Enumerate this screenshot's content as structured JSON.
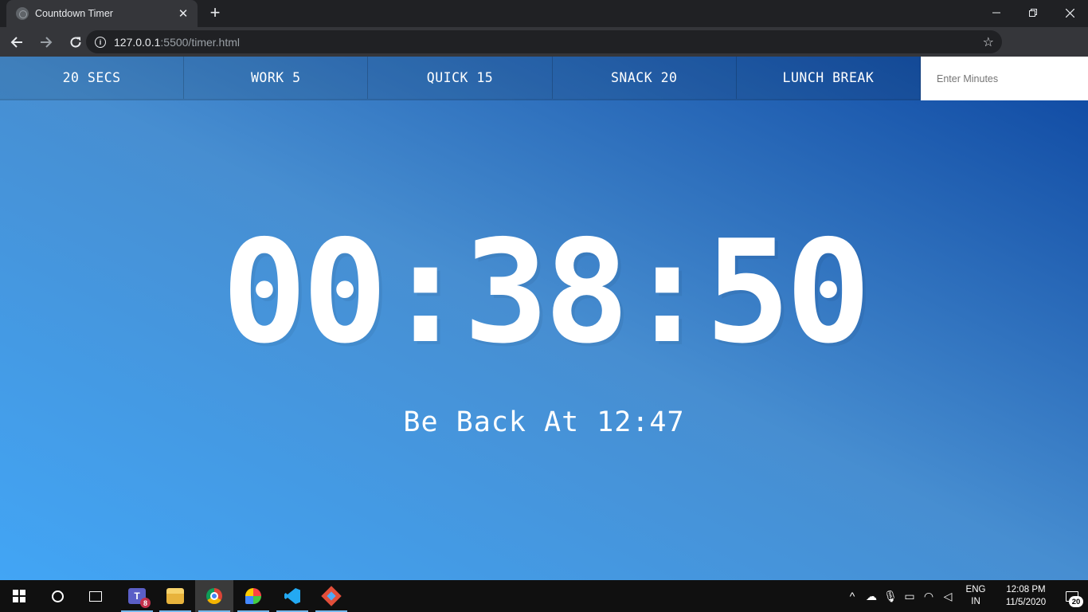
{
  "browser": {
    "tab_title": "Countdown Timer",
    "new_tab_icon": "plus-icon",
    "url_host": "127.0.0.1",
    "url_rest": ":5500/timer.html"
  },
  "timer": {
    "buttons": [
      {
        "label": "20 SECS"
      },
      {
        "label": "WORK 5"
      },
      {
        "label": "QUICK 15"
      },
      {
        "label": "SNACK 20"
      },
      {
        "label": "LUNCH BREAK"
      }
    ],
    "input_placeholder": "Enter Minutes",
    "time_left": "00:38:50",
    "end_time": "Be Back At 12:47",
    "gradient": {
      "start": "#42a5f5",
      "mid": "#478ed1",
      "end": "#0d47a1"
    }
  },
  "taskbar": {
    "teams_badge": "8",
    "language_line1": "ENG",
    "language_line2": "IN",
    "time": "12:08 PM",
    "date": "11/5/2020",
    "notification_count": "20"
  }
}
